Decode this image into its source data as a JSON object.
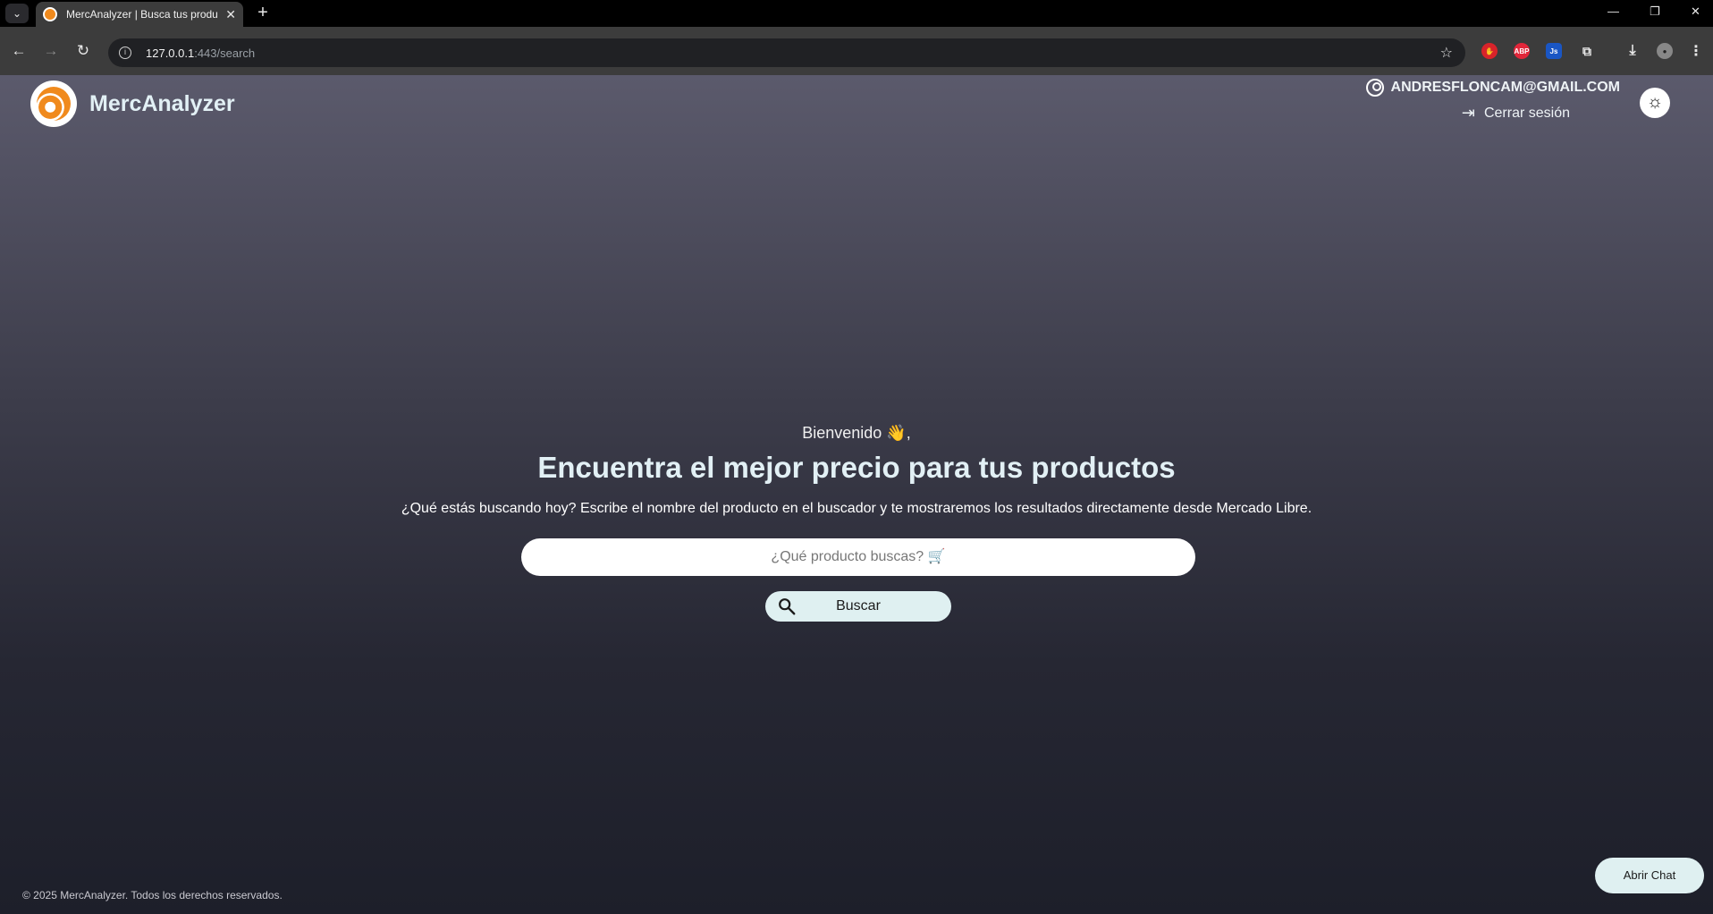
{
  "browser": {
    "tab_title": "MercAnalyzer | Busca tus produ",
    "url_host": "127.0.0.1",
    "url_rest": ":443/search"
  },
  "header": {
    "brand": "MercAnalyzer",
    "user_email": "ANDRESFLONCAM@GMAIL.COM",
    "logout_label": "Cerrar sesión"
  },
  "hero": {
    "welcome": "Bienvenido 👋,",
    "headline": "Encuentra el mejor precio para tus productos",
    "subtitle": "¿Qué estás buscando hoy? Escribe el nombre del producto en el buscador y te mostraremos los resultados directamente desde Mercado Libre."
  },
  "search": {
    "placeholder": "¿Qué producto buscas? 🛒",
    "value": "",
    "button_label": "Buscar"
  },
  "footer": {
    "copyright": "© 2025 MercAnalyzer. Todos los derechos reservados."
  },
  "chat": {
    "button_label": "Abrir Chat"
  },
  "colors": {
    "brand_orange": "#f08a1d",
    "button_bg": "#dff0f1",
    "headline": "#e2f0f5"
  },
  "icons": [
    "tab-list-icon",
    "favicon-icon",
    "close-icon",
    "plus-icon",
    "back-icon",
    "forward-icon",
    "reload-icon",
    "info-icon",
    "star-icon",
    "user-icon",
    "logout-icon",
    "sun-icon",
    "search-icon"
  ]
}
